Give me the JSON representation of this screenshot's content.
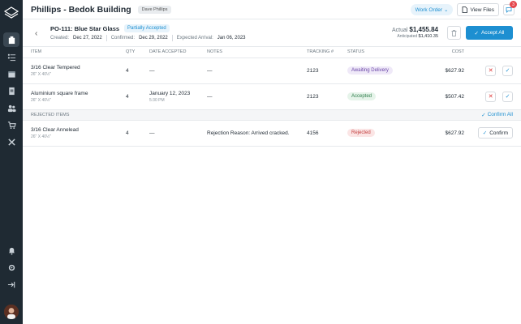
{
  "header": {
    "title": "Phillips - Bedok Building",
    "owner_tag": "Dave Phillips",
    "work_order_label": "Work Order",
    "view_files_label": "View Files",
    "chat_badge": "3"
  },
  "po": {
    "title": "PO-111: Blue Star Glass",
    "status": "Partially Accepted",
    "created_label": "Created:",
    "created": "Dec 27, 2022",
    "confirmed_label": "Confirmed:",
    "confirmed": "Dec 29, 2022",
    "expected_label": "Expected Arrival:",
    "expected": "Jan 06, 2023",
    "actual_label": "Actual",
    "actual": "$1,455.84",
    "anticipated_label": "Anticipated",
    "anticipated": "$1,410.35",
    "accept_all_label": "Accept All"
  },
  "table": {
    "columns": {
      "item": "ITEM",
      "qty": "QTY",
      "date": "DATE ACCEPTED",
      "notes": "NOTES",
      "tracking": "TRACKING #",
      "status": "STATUS",
      "cost": "COST"
    },
    "rows": [
      {
        "name": "3/16 Clear Tempered",
        "size": "26\" X 40½\"",
        "qty": "4",
        "date": "—",
        "time": "",
        "notes": "—",
        "tracking": "2123",
        "status": "Awaiting Delivery",
        "cost": "$627.92"
      },
      {
        "name": "Aluminium square frame",
        "size": "26\" X 40½\"",
        "qty": "4",
        "date": "January 12, 2023",
        "time": "5:30 PM",
        "notes": "—",
        "tracking": "2123",
        "status": "Accepted",
        "cost": "$507.42"
      }
    ],
    "rejected_label": "REJECTED ITEMS",
    "confirm_all_label": "Confirm All",
    "rejected_rows": [
      {
        "name": "3/16 Clear Annelead",
        "size": "26\" X 40½\"",
        "qty": "4",
        "date": "—",
        "notes": "Rejection Reason: Arrived cracked.",
        "tracking": "4156",
        "status": "Rejected",
        "cost": "$627.92",
        "confirm_label": "Confirm"
      }
    ]
  },
  "colors": {
    "accent": "#1d8fd1",
    "rail": "#1f2a33",
    "danger": "#d33"
  },
  "icons": [
    "logo-icon",
    "building-icon",
    "checklist-icon",
    "calendar-icon",
    "document-icon",
    "team-icon",
    "cart-icon",
    "tools-icon",
    "bell-icon",
    "settings-icon",
    "logout-icon"
  ]
}
